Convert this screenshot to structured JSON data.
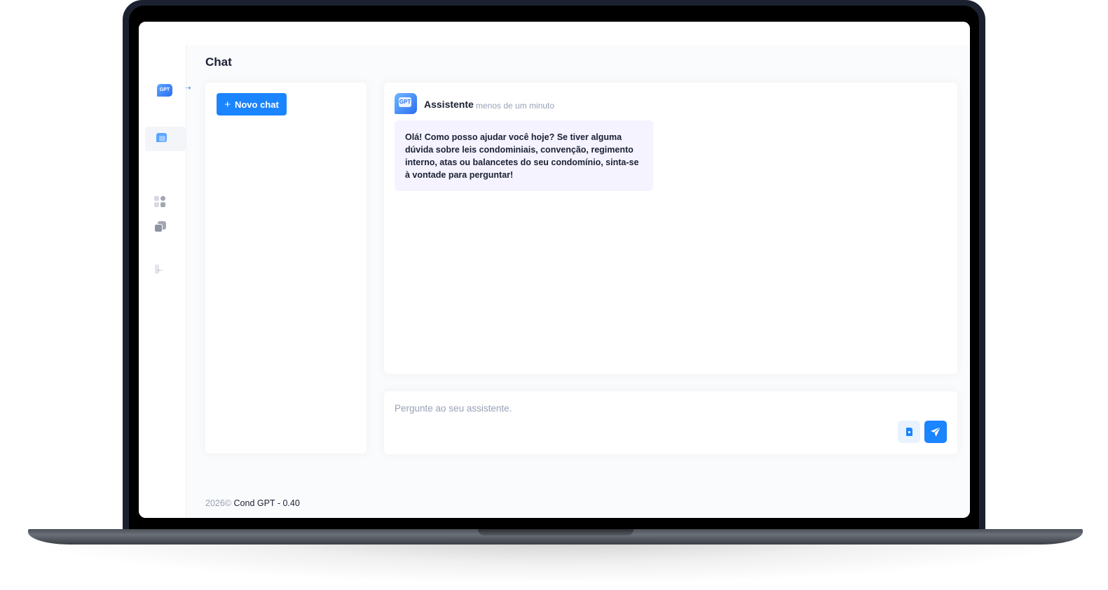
{
  "app": {
    "logo_text": "GPT",
    "brand_color": "#1b84ff"
  },
  "sidebar": {
    "items": [
      {
        "name": "chat",
        "icon": "chat-bubble-icon",
        "active": true
      },
      {
        "name": "dashboard",
        "icon": "dashboard-grid-icon",
        "active": false
      },
      {
        "name": "documents",
        "icon": "documents-icon",
        "active": false
      },
      {
        "name": "logout",
        "icon": "logout-icon",
        "active": false
      }
    ],
    "toggle_icon": "arrow-right-icon",
    "logout_glyph": "←"
  },
  "page": {
    "title": "Chat"
  },
  "chat_list": {
    "new_chat_label": "Novo chat",
    "plus_glyph": "+"
  },
  "conversation": {
    "avatar_text": "GPT",
    "sender": "Assistente",
    "timestamp": "menos de um minuto",
    "message": "Olá! Como posso ajudar você hoje? Se tiver alguma dúvida sobre leis condominiais, convenção, regimento interno, atas ou balancetes do seu condomínio, sinta-se à vontade para perguntar!"
  },
  "composer": {
    "placeholder": "Pergunte ao seu assistente.",
    "value": "",
    "attach_icon": "document-icon",
    "send_icon": "send-icon"
  },
  "footer": {
    "year": "2026©",
    "app_version": "Cond GPT - 0.40"
  }
}
